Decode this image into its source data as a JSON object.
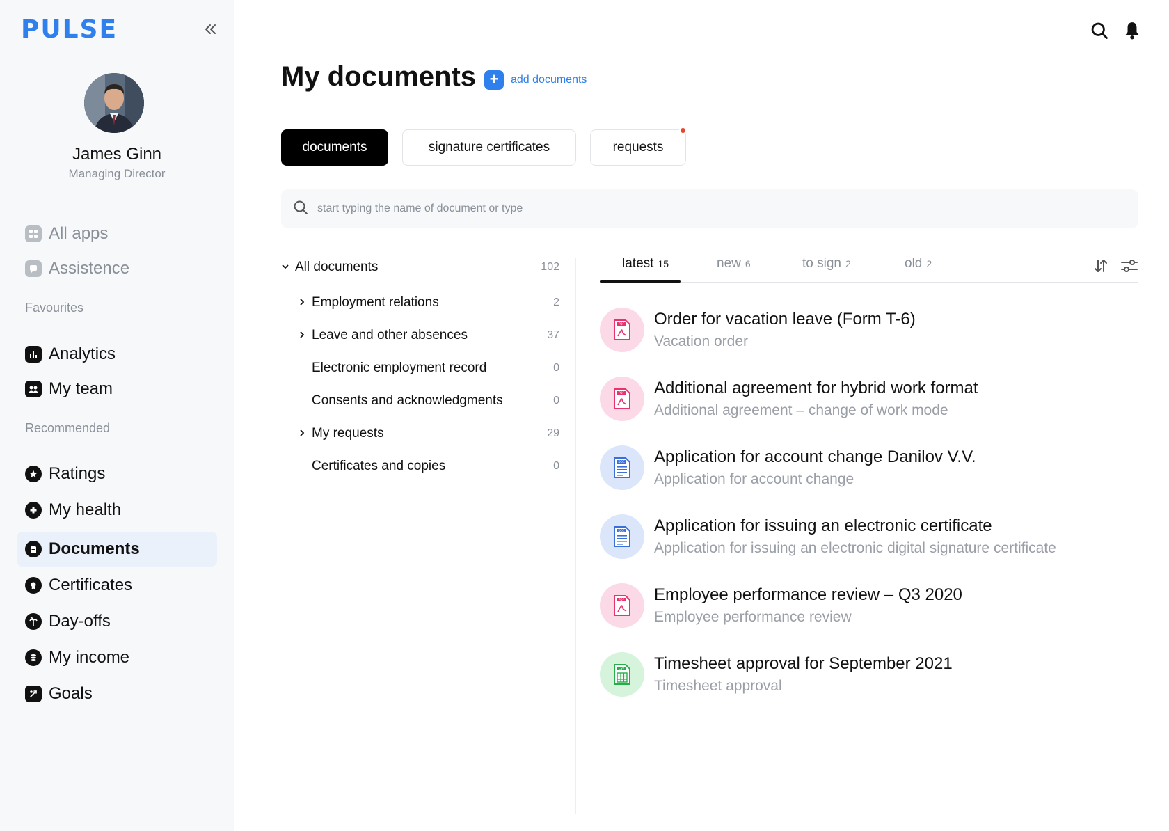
{
  "app": {
    "logo": "PULSE"
  },
  "profile": {
    "name": "James Ginn",
    "role": "Managing Director"
  },
  "sidebar": {
    "top_items": [
      {
        "label": "All apps",
        "icon": "grid-icon"
      },
      {
        "label": "Assistence",
        "icon": "chat-icon"
      }
    ],
    "favourites_label": "Favourites",
    "favourites": [
      {
        "label": "Analytics",
        "icon": "bar-chart-icon"
      },
      {
        "label": "My team",
        "icon": "team-icon"
      }
    ],
    "recommended_label": "Recommended",
    "recommended": [
      {
        "label": "Ratings",
        "icon": "star-icon"
      },
      {
        "label": "My health",
        "icon": "health-icon"
      },
      {
        "label": "Documents",
        "icon": "document-icon",
        "active": true
      },
      {
        "label": "Certificates",
        "icon": "certificate-icon"
      },
      {
        "label": "Day-offs",
        "icon": "palm-icon"
      },
      {
        "label": "My income",
        "icon": "coins-icon"
      },
      {
        "label": "Goals",
        "icon": "goal-icon"
      }
    ]
  },
  "main": {
    "title": "My documents",
    "add_label": "add documents",
    "tabs": [
      {
        "label": "documents",
        "active": true
      },
      {
        "label": "signature certificates"
      },
      {
        "label": "requests",
        "notification": true
      }
    ],
    "search_placeholder": "start typing the name of document or type",
    "tree": [
      {
        "label": "All documents",
        "count": "102",
        "expanded": true,
        "level": 0
      },
      {
        "label": "Employment relations",
        "count": "2",
        "level": 1,
        "has_children": true
      },
      {
        "label": "Leave and other absences",
        "count": "37",
        "level": 1,
        "has_children": true
      },
      {
        "label": "Electronic employment record",
        "count": "0",
        "level": 1
      },
      {
        "label": "Consents and acknowledgments",
        "count": "0",
        "level": 1
      },
      {
        "label": "My requests",
        "count": "29",
        "level": 1,
        "has_children": true
      },
      {
        "label": "Certificates and copies",
        "count": "0",
        "level": 1
      }
    ],
    "filters": [
      {
        "label": "latest",
        "count": "15",
        "active": true
      },
      {
        "label": "new",
        "count": "6"
      },
      {
        "label": "to sign",
        "count": "2"
      },
      {
        "label": "old",
        "count": "2"
      }
    ],
    "documents": [
      {
        "title": "Order for vacation leave (Form T-6)",
        "subtitle": "Vacation order",
        "type": "PDF"
      },
      {
        "title": "Additional agreement for hybrid work format",
        "subtitle": "Additional agreement – change of work mode",
        "type": "PDF"
      },
      {
        "title": "Application for account change Danilov V.V.",
        "subtitle": "Application for account change",
        "type": "DOC"
      },
      {
        "title": "Application for issuing an electronic certificate",
        "subtitle": "Application for issuing an electronic digital signature certificate",
        "type": "DOC"
      },
      {
        "title": "Employee performance review – Q3 2020",
        "subtitle": "Employee performance review",
        "type": "PDF"
      },
      {
        "title": "Timesheet approval for September 2021",
        "subtitle": "Timesheet approval",
        "type": "CSV"
      }
    ]
  },
  "colors": {
    "accent": "#2f80ed",
    "notification": "#e8472f",
    "pdf": "#e8336d",
    "doc": "#3b6fd8",
    "csv": "#27ae4a"
  }
}
